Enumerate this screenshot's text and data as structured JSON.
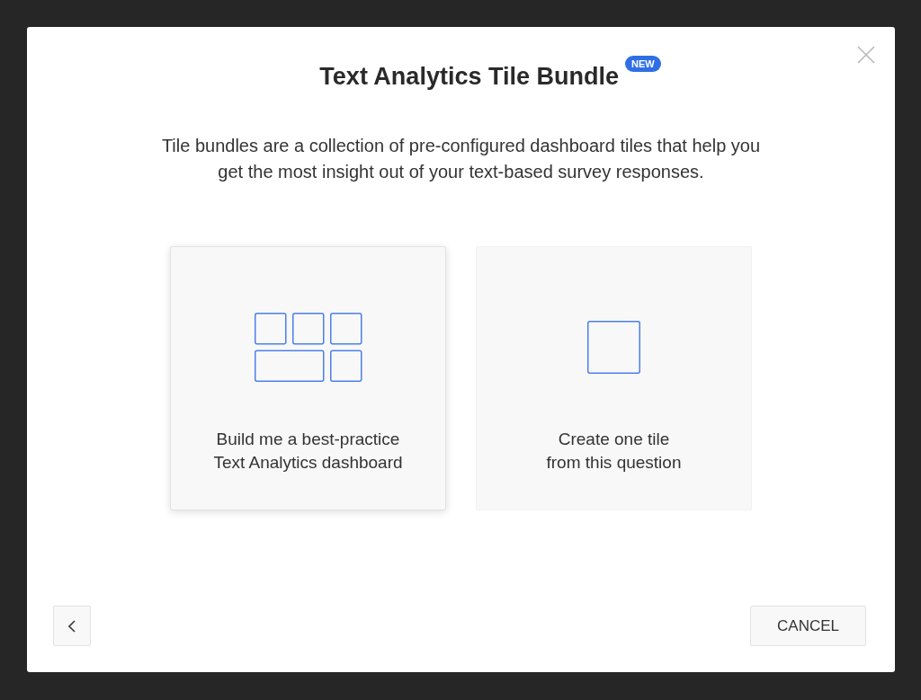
{
  "dialog": {
    "title": "Text Analytics Tile Bundle",
    "badge": "NEW",
    "description": "Tile bundles are a collection of pre-configured dashboard tiles that help you get the most insight out of your text-based survey responses.",
    "options": [
      {
        "kind": "dashboard",
        "label": "Build me a best-practice\nText Analytics dashboard",
        "selected": true
      },
      {
        "kind": "single",
        "label": "Create one tile\nfrom this question",
        "selected": false
      }
    ],
    "footer": {
      "cancel": "CANCEL"
    }
  }
}
